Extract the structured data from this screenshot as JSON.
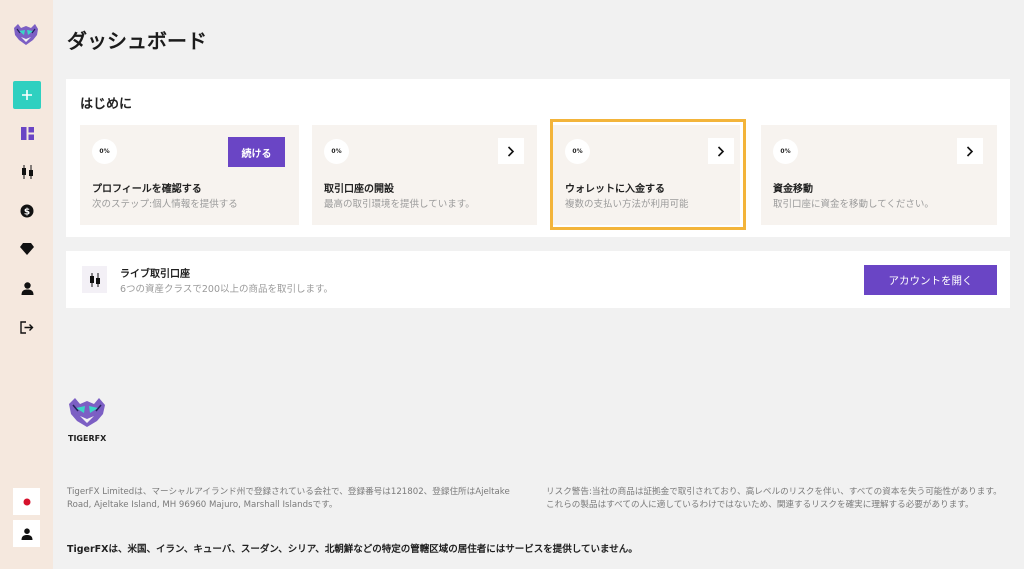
{
  "brand": {
    "name": "TIGERFX"
  },
  "sidebar": {
    "items": [
      {
        "icon": "plus-icon"
      },
      {
        "icon": "dashboard-icon"
      },
      {
        "icon": "candlestick-icon"
      },
      {
        "icon": "dollar-icon"
      },
      {
        "icon": "diamond-icon"
      },
      {
        "icon": "user-icon"
      },
      {
        "icon": "logout-icon"
      }
    ],
    "bottom": [
      {
        "icon": "japan-flag-icon"
      },
      {
        "icon": "profile-icon"
      }
    ]
  },
  "page": {
    "title": "ダッシュボード"
  },
  "start": {
    "heading": "はじめに",
    "cards": [
      {
        "progress": "0%",
        "title": "プロフィールを確認する",
        "description": "次のステップ:個人情報を提供する",
        "button": "続ける"
      },
      {
        "progress": "0%",
        "title": "取引口座の開設",
        "description": "最高の取引環境を提供しています。"
      },
      {
        "progress": "0%",
        "title": "ウォレットに入金する",
        "description": "複数の支払い方法が利用可能"
      },
      {
        "progress": "0%",
        "title": "資金移動",
        "description": "取引口座に資金を移動してください。"
      }
    ]
  },
  "live_account": {
    "title": "ライブ取引口座",
    "description": "6つの資産クラスで200以上の商品を取引します。",
    "button": "アカウントを開く"
  },
  "footer": {
    "company": "TigerFX Limitedは、マーシャルアイランド州で登録されている会社で、登録番号は121802、登録住所はAjeltake Road, Ajeltake Island, MH 96960 Majuro, Marshall Islandsです。",
    "risk": "リスク警告:当社の商品は証拠金で取引されており、高レベルのリスクを伴い、すべての資本を失う可能性があります。これらの製品はすべての人に適しているわけではないため、関連するリスクを確実に理解する必要があります。",
    "notice": "TigerFXは、米国、イラン、キューバ、スーダン、シリア、北朝鮮などの特定の管轄区域の居住者にはサービスを提供していません。"
  },
  "colors": {
    "accent": "#6a45c5",
    "teal": "#2fd0c0",
    "highlight": "#f3b43a",
    "sidebar": "#f5e8de"
  }
}
